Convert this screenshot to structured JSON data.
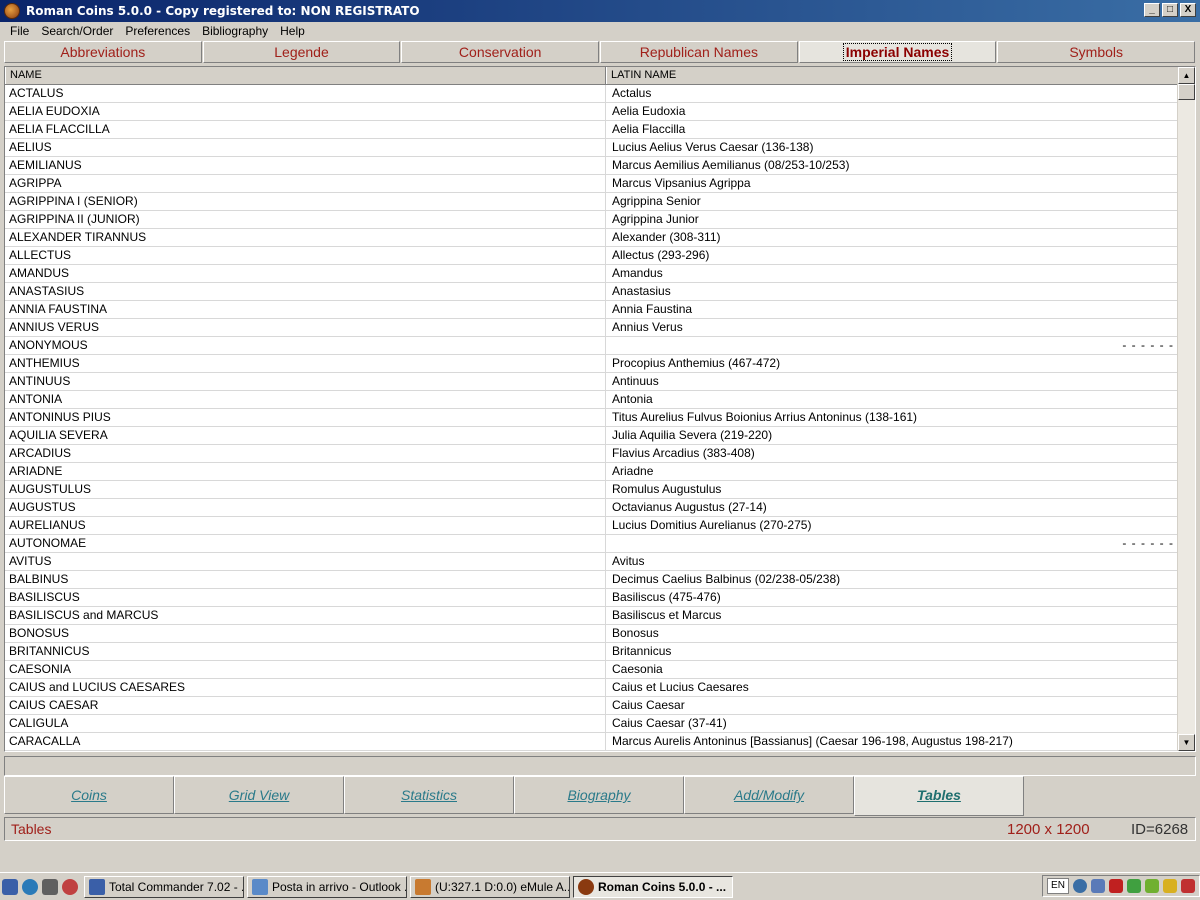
{
  "window": {
    "title": "Roman Coins 5.0.0 - Copy registered to:  NON REGISTRATO",
    "min_label": "_",
    "max_label": "□",
    "close_label": "X"
  },
  "menu": [
    "File",
    "Search/Order",
    "Preferences",
    "Bibliography",
    "Help"
  ],
  "top_tabs": [
    {
      "label": "Abbreviations",
      "active": false
    },
    {
      "label": "Legende",
      "active": false
    },
    {
      "label": "Conservation",
      "active": false
    },
    {
      "label": "Republican Names",
      "active": false
    },
    {
      "label": "Imperial Names",
      "active": true
    },
    {
      "label": "Symbols",
      "active": false
    }
  ],
  "grid": {
    "headers": [
      "NAME",
      "LATIN NAME"
    ],
    "rows": [
      [
        "ACTALUS",
        "Actalus"
      ],
      [
        "AELIA EUDOXIA",
        "Aelia Eudoxia"
      ],
      [
        "AELIA FLACCILLA",
        "Aelia Flaccilla"
      ],
      [
        "AELIUS",
        "Lucius Aelius Verus Caesar (136-138)"
      ],
      [
        "AEMILIANUS",
        "Marcus Aemilius Aemilianus (08/253-10/253)"
      ],
      [
        "AGRIPPA",
        "Marcus Vipsanius Agrippa"
      ],
      [
        "AGRIPPINA I (SENIOR)",
        "Agrippina Senior"
      ],
      [
        "AGRIPPINA II (JUNIOR)",
        "Agrippina Junior"
      ],
      [
        "ALEXANDER TIRANNUS",
        "Alexander (308-311)"
      ],
      [
        "ALLECTUS",
        "Allectus (293-296)"
      ],
      [
        "AMANDUS",
        "Amandus"
      ],
      [
        "ANASTASIUS",
        "Anastasius"
      ],
      [
        "ANNIA FAUSTINA",
        "Annia Faustina"
      ],
      [
        "ANNIUS VERUS",
        "Annius Verus"
      ],
      [
        "ANONYMOUS",
        "- - - - - -"
      ],
      [
        "ANTHEMIUS",
        "Procopius Anthemius (467-472)"
      ],
      [
        "ANTINUUS",
        "Antinuus"
      ],
      [
        "ANTONIA",
        "Antonia"
      ],
      [
        "ANTONINUS PIUS",
        "Titus Aurelius Fulvus Boionius Arrius Antoninus (138-161)"
      ],
      [
        "AQUILIA SEVERA",
        "Julia Aquilia Severa (219-220)"
      ],
      [
        "ARCADIUS",
        "Flavius Arcadius (383-408)"
      ],
      [
        "ARIADNE",
        "Ariadne"
      ],
      [
        "AUGUSTULUS",
        "Romulus Augustulus"
      ],
      [
        "AUGUSTUS",
        "Octavianus Augustus (27-14)"
      ],
      [
        "AURELIANUS",
        "Lucius Domitius Aurelianus (270-275)"
      ],
      [
        "AUTONOMAE",
        "- - - - - -"
      ],
      [
        "AVITUS",
        "Avitus"
      ],
      [
        "BALBINUS",
        "Decimus Caelius Balbinus (02/238-05/238)"
      ],
      [
        "BASILISCUS",
        "Basiliscus (475-476)"
      ],
      [
        "BASILISCUS and MARCUS",
        "Basiliscus et Marcus"
      ],
      [
        "BONOSUS",
        "Bonosus"
      ],
      [
        "BRITANNICUS",
        "Britannicus"
      ],
      [
        "CAESONIA",
        "Caesonia"
      ],
      [
        "CAIUS and LUCIUS CAESARES",
        "Caius et Lucius Caesares"
      ],
      [
        "CAIUS CAESAR",
        "Caius Caesar"
      ],
      [
        "CALIGULA",
        "Caius Caesar (37-41)"
      ],
      [
        "CARACALLA",
        "Marcus Aurelis Antoninus [Bassianus] (Caesar 196-198, Augustus 198-217)"
      ]
    ]
  },
  "scroll": {
    "up": "▲",
    "down": "▼"
  },
  "bottom_tabs": [
    {
      "label": "Coins",
      "active": false
    },
    {
      "label": "Grid View",
      "active": false
    },
    {
      "label": "Statistics",
      "active": false
    },
    {
      "label": "Biography",
      "active": false
    },
    {
      "label": "Add/Modify",
      "active": false
    },
    {
      "label": "Tables",
      "active": true
    }
  ],
  "status": {
    "section": "Tables",
    "dimensions": "1200 x 1200",
    "id": "ID=6268"
  },
  "taskbar": {
    "tasks": [
      {
        "label": "Total Commander 7.02 - ...",
        "active": false,
        "color": "#3a5fa8"
      },
      {
        "label": "Posta in arrivo - Outlook ...",
        "active": false,
        "color": "#5a8ac8"
      },
      {
        "label": "(U:327.1 D:0.0) eMule A...",
        "active": false,
        "color": "#c87a30"
      },
      {
        "label": "Roman Coins 5.0.0 - ...",
        "active": true,
        "color": "#8a3a10"
      }
    ],
    "lang": "EN"
  },
  "colors": {
    "accent_red": "#a0201a",
    "teal_link": "#2a7a8a",
    "title_blue": "#0a246a"
  }
}
